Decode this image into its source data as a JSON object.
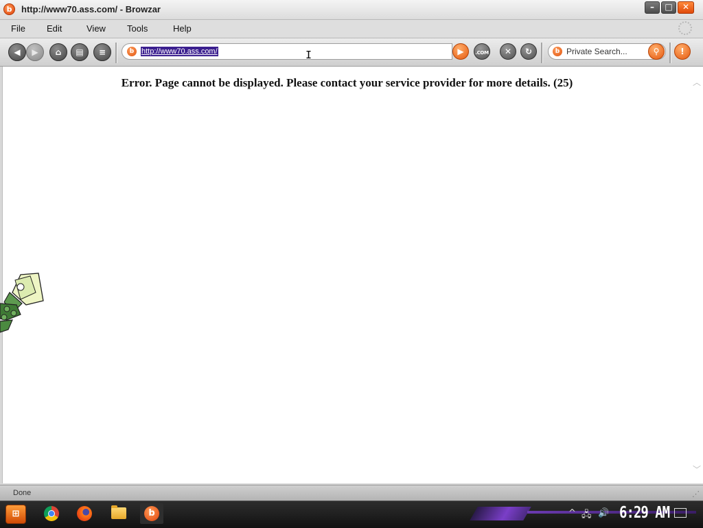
{
  "window": {
    "title": "http://www70.ass.com/ - Browzar",
    "app_icon_glyph": "b",
    "min_glyph": "–",
    "max_glyph": "□",
    "close_glyph": "✕"
  },
  "menu": {
    "items": [
      "File",
      "Edit",
      "View",
      "Tools",
      "Help"
    ]
  },
  "toolbar": {
    "back_glyph": "◀",
    "forward_glyph": "▶",
    "home_glyph": "⌂",
    "print_glyph": "▤",
    "history_glyph": "≡",
    "address_icon_glyph": "b",
    "address_value": "http://www70.ass.com/",
    "go_glyph": "▶",
    "com_label": ".COM",
    "stop_glyph": "✕",
    "refresh_glyph": "↻",
    "search_placeholder": "Private Search...",
    "search_engine_glyph": "b",
    "search_go_glyph": "⚲",
    "alert_glyph": "!"
  },
  "content": {
    "error_message": "Error. Page cannot be displayed. Please contact your service provider for more details. (25)"
  },
  "statusbar": {
    "status": "Done"
  },
  "taskbar": {
    "start_glyph": "⊞",
    "apps": [
      "chrome-icon",
      "firefox-icon",
      "file-explorer-icon",
      "browzar-icon"
    ],
    "browzar_glyph": "b",
    "clock": "6:29 AM",
    "tray": {
      "chevron": "^",
      "network": "🖧",
      "volume": "🔊"
    }
  },
  "colors": {
    "accent_orange": "#e55a10",
    "selection": "#3b1f8f",
    "taskbar_purple": "#7a3ec8"
  }
}
